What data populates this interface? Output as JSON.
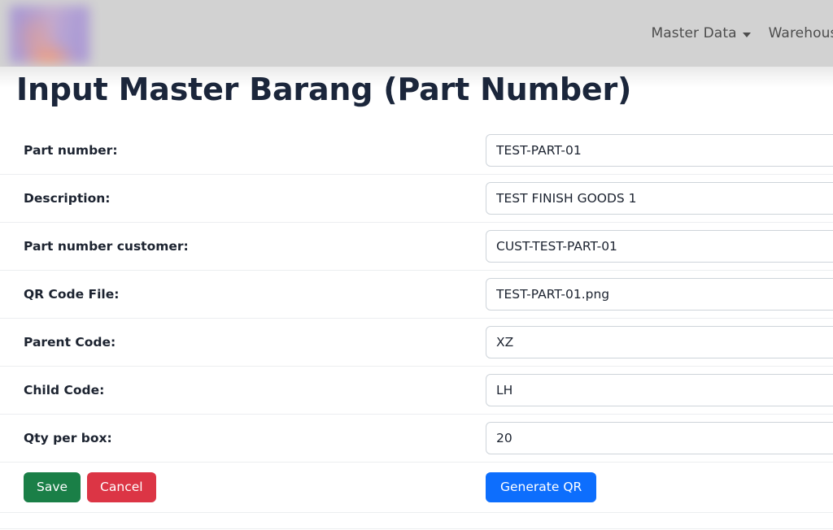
{
  "navbar": {
    "brand_logo_alt": "company-logo",
    "links": [
      {
        "label": "Master Data",
        "has_caret": true,
        "caret_icon": "chevron-down-icon"
      },
      {
        "label": "Warehouse",
        "has_caret": false
      }
    ]
  },
  "page": {
    "title": "Input Master Barang (Part Number)"
  },
  "form": {
    "rows": [
      {
        "label": "Part number:",
        "value": "TEST-PART-01",
        "placeholder": ""
      },
      {
        "label": "Description:",
        "value": "TEST FINISH GOODS 1",
        "placeholder": ""
      },
      {
        "label": "Part number customer:",
        "value": "CUST-TEST-PART-01",
        "placeholder": ""
      },
      {
        "label": "QR Code File:",
        "value": "TEST-PART-01.png",
        "placeholder": ""
      },
      {
        "label": "Parent Code:",
        "value": "XZ",
        "placeholder": ""
      },
      {
        "label": "Child Code:",
        "value": "LH",
        "placeholder": ""
      },
      {
        "label": "Qty per box:",
        "value": "20",
        "placeholder": ""
      }
    ]
  },
  "actions": {
    "save_label": "Save",
    "cancel_label": "Cancel",
    "generate_qr_label": "Generate QR"
  },
  "colors": {
    "navbar_bg": "#d2d2d2",
    "title": "#1b263b",
    "save": "#1a7f47",
    "cancel": "#dc3545",
    "primary": "#0d6efd",
    "divider": "#eceef0",
    "input_border": "#ced4da"
  }
}
